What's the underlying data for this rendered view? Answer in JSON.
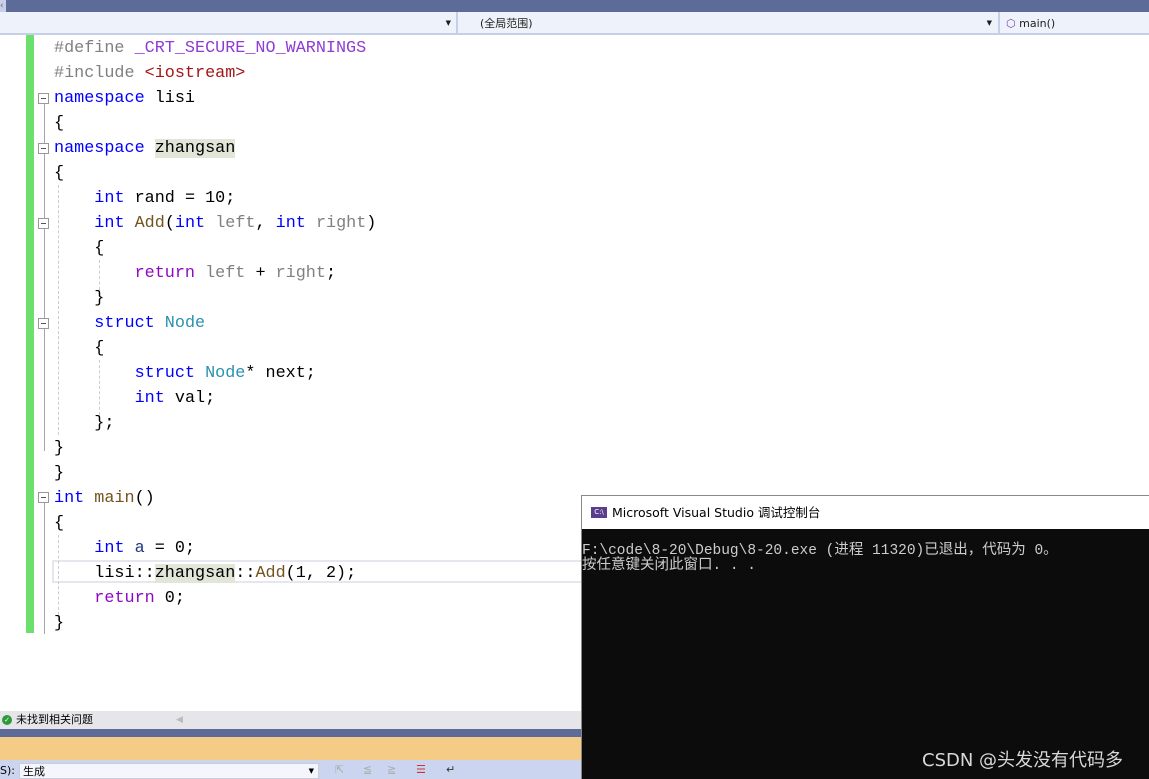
{
  "nav": {
    "project_dropdown": "",
    "scope_dropdown": "(全局范围)",
    "member_dropdown": "main()",
    "member_icon": "method-icon"
  },
  "code": {
    "lines": [
      [
        [
          "#define ",
          "pp"
        ],
        [
          "_CRT_SECURE_NO_WARNINGS",
          "mac"
        ]
      ],
      [
        [
          "#include ",
          "pp"
        ],
        [
          "<iostream>",
          "str"
        ]
      ],
      [
        [
          "namespace ",
          "kw"
        ],
        [
          "lisi",
          ""
        ]
      ],
      [
        [
          "{",
          ""
        ]
      ],
      [
        [
          "namespace ",
          "kw"
        ],
        [
          "zhangsan",
          "hl"
        ]
      ],
      [
        [
          "{",
          ""
        ]
      ],
      [
        [
          "    ",
          ""
        ],
        [
          "int ",
          "kw"
        ],
        [
          "rand = 10;",
          ""
        ]
      ],
      [
        [
          "    ",
          ""
        ],
        [
          "int ",
          "kw"
        ],
        [
          "Add",
          "fn"
        ],
        [
          "(",
          ""
        ],
        [
          "int ",
          "kw"
        ],
        [
          "left",
          "par"
        ],
        [
          ", ",
          ""
        ],
        [
          "int ",
          "kw"
        ],
        [
          "right",
          "par"
        ],
        [
          ")",
          ""
        ]
      ],
      [
        [
          "    {",
          ""
        ]
      ],
      [
        [
          "        ",
          ""
        ],
        [
          "return ",
          "ret"
        ],
        [
          "left",
          "par"
        ],
        [
          " + ",
          ""
        ],
        [
          "right",
          "par"
        ],
        [
          ";",
          ""
        ]
      ],
      [
        [
          "    }",
          ""
        ]
      ],
      [
        [
          "    ",
          ""
        ],
        [
          "struct ",
          "kw"
        ],
        [
          "Node",
          "ty"
        ]
      ],
      [
        [
          "    {",
          ""
        ]
      ],
      [
        [
          "        ",
          ""
        ],
        [
          "struct ",
          "kw"
        ],
        [
          "Node",
          "ty"
        ],
        [
          "* next;",
          ""
        ]
      ],
      [
        [
          "        ",
          ""
        ],
        [
          "int ",
          "kw"
        ],
        [
          "val;",
          ""
        ]
      ],
      [
        [
          "    };",
          ""
        ]
      ],
      [
        [
          "}",
          ""
        ]
      ],
      [
        [
          "}",
          ""
        ]
      ],
      [
        [
          "int ",
          "kw"
        ],
        [
          "main",
          "fn"
        ],
        [
          "()",
          ""
        ]
      ],
      [
        [
          "{",
          ""
        ]
      ],
      [
        [
          "    ",
          ""
        ],
        [
          "int ",
          "kw"
        ],
        [
          "a",
          "var"
        ],
        [
          " = 0;",
          ""
        ]
      ],
      [
        [
          "    lisi::",
          ""
        ],
        [
          "zhangsan",
          "hl"
        ],
        [
          "::",
          ""
        ],
        [
          "Add",
          "fn"
        ],
        [
          "(1, 2);",
          ""
        ]
      ],
      [
        [
          "    ",
          ""
        ],
        [
          "return ",
          "ret"
        ],
        [
          "0;",
          ""
        ]
      ],
      [
        [
          "}",
          ""
        ]
      ]
    ]
  },
  "status": {
    "message": "未找到相关问题"
  },
  "output_bar": {
    "label": "S):",
    "source": "生成"
  },
  "console": {
    "title": "Microsoft Visual Studio 调试控制台",
    "icon_text": "C:\\",
    "lines": [
      "F:\\code\\8-20\\Debug\\8-20.exe (进程 11320)已退出，代码为 0。",
      "按任意键关闭此窗口. . ."
    ]
  },
  "watermark": "CSDN @头发没有代码多"
}
